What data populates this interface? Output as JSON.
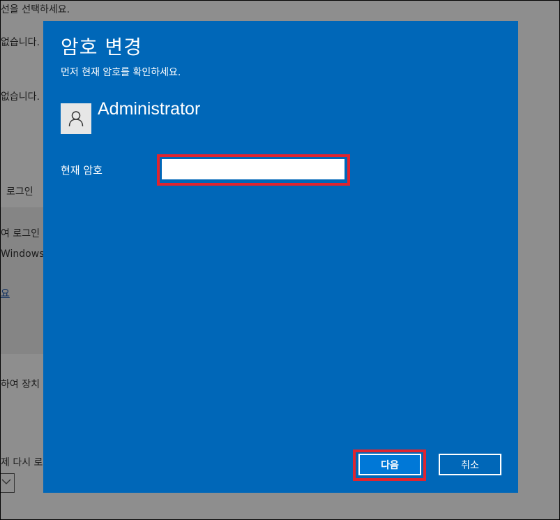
{
  "background": {
    "lines": [
      "선을 선택하세요.",
      "없습니다.",
      "없습니다.",
      "로그인",
      "여 로그인",
      "Windows,",
      "요",
      "하여 장치",
      "제 다시 로"
    ]
  },
  "dialog": {
    "title": "암호 변경",
    "subtitle": "먼저 현재 암호를 확인하세요.",
    "user": {
      "name": "Administrator",
      "avatar_icon": "person-icon"
    },
    "password": {
      "label": "현재 암호",
      "value": "",
      "placeholder": ""
    },
    "buttons": {
      "next": "다음",
      "cancel": "취소"
    },
    "colors": {
      "dialog_bg": "#0067b8",
      "highlight": "#e0242f",
      "primary_button": "#0078d7"
    }
  }
}
